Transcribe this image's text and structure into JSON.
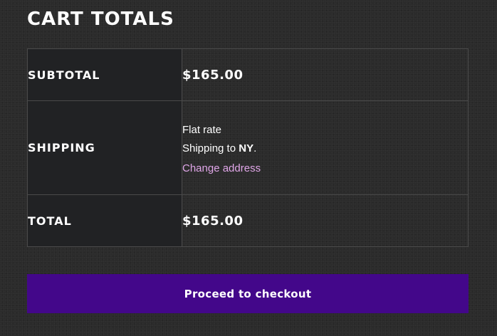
{
  "cart_totals": {
    "heading": "CART TOTALS",
    "subtotal": {
      "label": "SUBTOTAL",
      "amount": "$165.00"
    },
    "shipping": {
      "label": "SHIPPING",
      "method": "Flat rate",
      "destination_prefix": "Shipping to ",
      "destination_state": "NY",
      "destination_suffix": ".",
      "change_address_label": "Change address"
    },
    "total": {
      "label": "TOTAL",
      "amount": "$165.00"
    },
    "checkout_button_label": "Proceed to checkout"
  },
  "colors": {
    "background": "#2b2b2b",
    "label_cell_background": "#212224",
    "border": "#4a4a4a",
    "link": "#e0a6e8",
    "checkout_button": "#43078a"
  }
}
